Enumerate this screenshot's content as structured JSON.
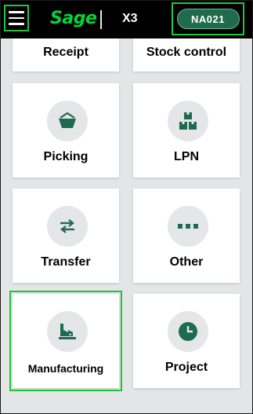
{
  "header": {
    "menu_icon": "hamburger-icon",
    "logo_text": "Sage",
    "app_name": "X3",
    "site_code": "NA021"
  },
  "tiles": [
    {
      "label": "Receipt"
    },
    {
      "label": "Stock control"
    },
    {
      "label": "Picking",
      "icon": "basket-icon"
    },
    {
      "label": "LPN",
      "icon": "boxes-icon"
    },
    {
      "label": "Transfer",
      "icon": "transfer-arrows-icon"
    },
    {
      "label": "Other",
      "icon": "more-dots-icon"
    },
    {
      "label": "Manufacturing",
      "icon": "factory-icon"
    },
    {
      "label": "Project",
      "icon": "clock-icon"
    }
  ],
  "colors": {
    "accent_green": "#00d639",
    "icon_green": "#1e6b4e",
    "focus_outline": "#22c53a",
    "header_bg": "#000000",
    "page_bg": "#e3e5e6"
  }
}
